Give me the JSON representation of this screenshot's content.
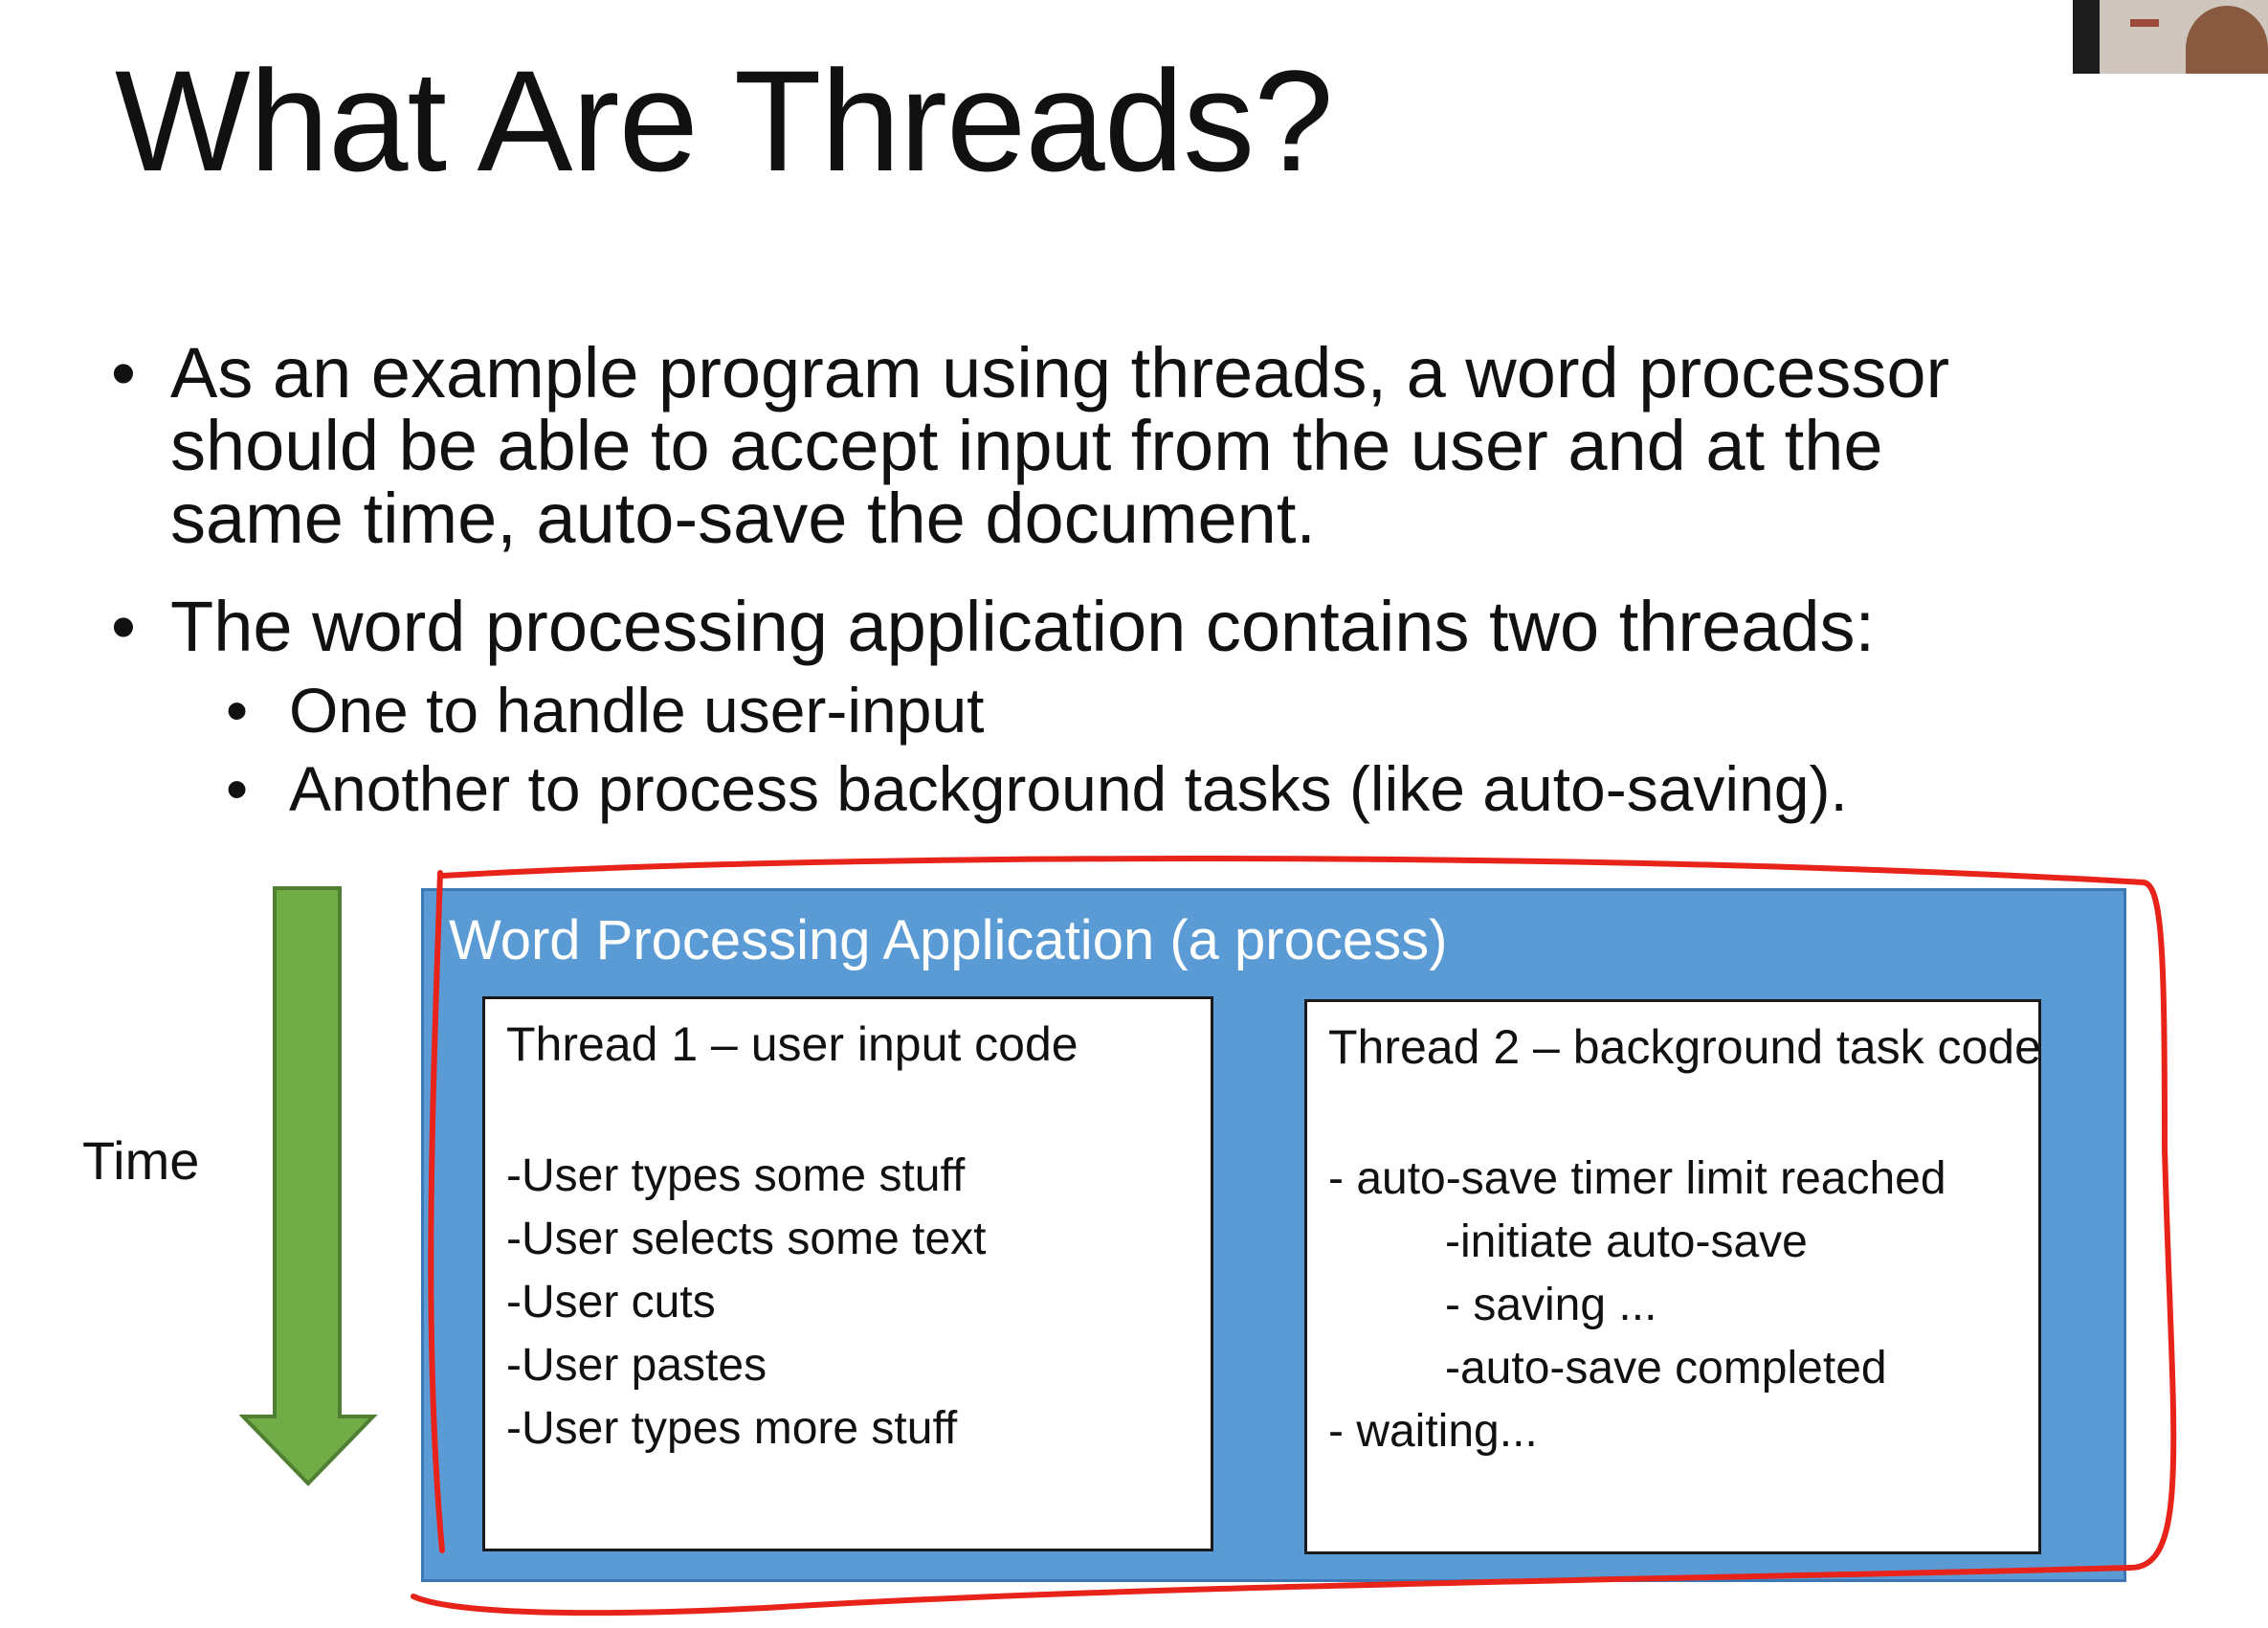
{
  "slide": {
    "title": "What Are Threads?",
    "bullets": [
      {
        "lines": [
          "As an example program using threads, a word processor",
          "should be able to accept input from the user and at the",
          "same time, auto-save the document."
        ]
      },
      {
        "lines": [
          "The word processing application contains two threads:"
        ],
        "sub": [
          " One to handle user-input",
          "Another to process background tasks (like auto-saving)."
        ]
      }
    ],
    "bullet_char": "•"
  },
  "diagram": {
    "time_label": "Time",
    "process_title": "Word Processing Application (a process)",
    "thread1": {
      "title": "Thread 1 – user input code",
      "lines": [
        "-User types some stuff",
        "-User selects some text",
        "-User cuts",
        "-User pastes",
        "-User types more stuff"
      ]
    },
    "thread2": {
      "title": "Thread 2 – background task code",
      "lines": [
        "- auto-save timer limit reached",
        "-initiate auto-save",
        "- saving ...",
        "-auto-save completed",
        "- waiting..."
      ]
    },
    "colors": {
      "process_fill": "#5b9bd5",
      "arrow_fill": "#70ad47",
      "annotation": "#e8231a"
    }
  }
}
